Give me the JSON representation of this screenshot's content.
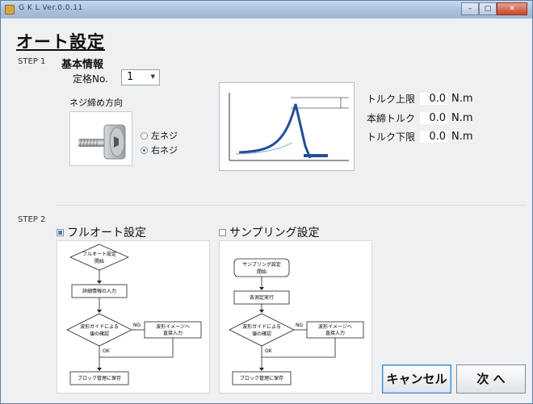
{
  "window": {
    "title": "G K L   Ver.0.0.11",
    "min_glyph": "–",
    "max_glyph": "□",
    "close_glyph": "✕"
  },
  "page_title": "オート設定",
  "step1": {
    "label": "STEP 1",
    "section": "基本情報",
    "spec_no_label": "定格No.",
    "spec_no_value": "1",
    "direction_label": "ネジ締め方向",
    "options": [
      {
        "label": "左ネジ",
        "selected": false
      },
      {
        "label": "右ネジ",
        "selected": true
      }
    ],
    "torque": [
      {
        "label": "トルク上限",
        "value": "0.0",
        "unit": "N.m"
      },
      {
        "label": "本締トルク",
        "value": "0.0",
        "unit": "N.m"
      },
      {
        "label": "トルク下限",
        "value": "0.0",
        "unit": "N.m"
      }
    ]
  },
  "step2": {
    "label": "STEP 2",
    "full_auto": {
      "label": "フルオート設定",
      "checked": true
    },
    "sampling": {
      "label": "サンプリング設定",
      "checked": false
    },
    "flow_full": {
      "start_1": "フルオート設定",
      "start_2": "開始",
      "step": "詳細情報の入力",
      "decision_1": "波形ガイドによる",
      "decision_2": "値の確認",
      "ng": "NG",
      "side_1": "波形イメージへ",
      "side_2": "直接入力",
      "ok": "OK",
      "end": "ブロック管理に保存"
    },
    "flow_sampling": {
      "start_1": "サンプリング設定",
      "start_2": "開始",
      "step": "各測定実行",
      "decision_1": "波形ガイドによる",
      "decision_2": "値の確認",
      "ng": "NG",
      "side_1": "波形イメージへ",
      "side_2": "直接入力",
      "ok": "OK",
      "end": "ブロック管理に保存"
    }
  },
  "buttons": {
    "cancel": "キャンセル",
    "next": "次 へ"
  },
  "colors": {
    "accent": "#2a4f9a",
    "titlebar": "#a9c1dc"
  }
}
